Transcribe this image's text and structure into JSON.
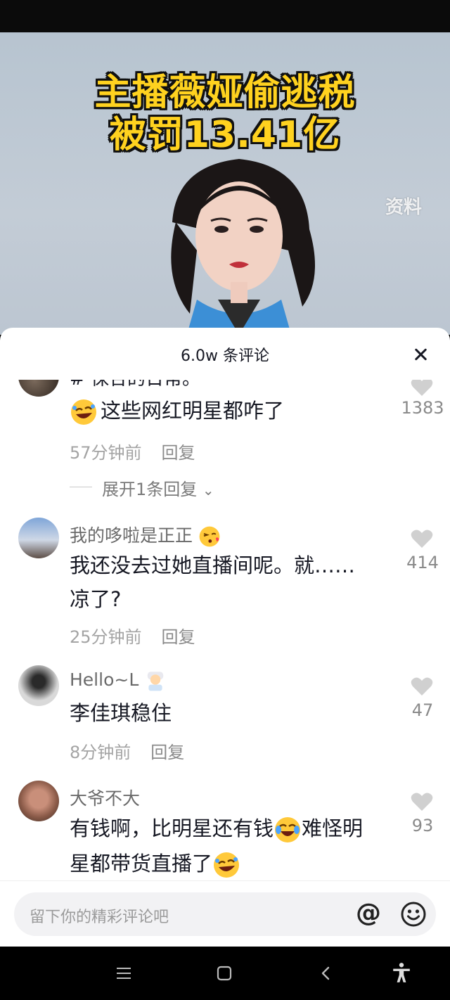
{
  "video": {
    "title_line1": "主播薇娅偷逃税",
    "title_line2": "被罚13.41亿",
    "watermark": "资料"
  },
  "comments_header": {
    "title": "6.0w 条评论"
  },
  "comments": [
    {
      "partial_text": "# 保合的日常。",
      "text": "这些网红明星都咋了",
      "time": "57分钟前",
      "reply_label": "回复",
      "likes": "1383",
      "expand_label": "展开1条回复"
    },
    {
      "username": "我的哆啦是正正",
      "text_line1": "我还没去过她直播间呢。就……",
      "text_line2": "凉了?",
      "time": "25分钟前",
      "reply_label": "回复",
      "likes": "414"
    },
    {
      "username": "Hello~L",
      "text": "李佳琪稳住",
      "time": "8分钟前",
      "reply_label": "回复",
      "likes": "47"
    },
    {
      "username": "大爷不大",
      "text_line1_a": "有钱啊，比明星还有钱",
      "text_line1_b": "难怪明",
      "text_line2": "星都带货直播了",
      "likes": "93"
    }
  ],
  "input": {
    "placeholder": "留下你的精彩评论吧",
    "at_symbol": "@"
  },
  "icons": {
    "close": "close-icon",
    "heart": "heart-icon",
    "at": "at-icon",
    "emoji": "smile-icon",
    "nav_menu": "menu-icon",
    "nav_home": "home-icon",
    "nav_back": "back-icon",
    "nav_accessibility": "accessibility-icon"
  },
  "colors": {
    "title_yellow": "#ffd21f",
    "text_primary": "#161823",
    "text_secondary": "#a4a4a4",
    "heart_gray": "#d0d0d0"
  }
}
